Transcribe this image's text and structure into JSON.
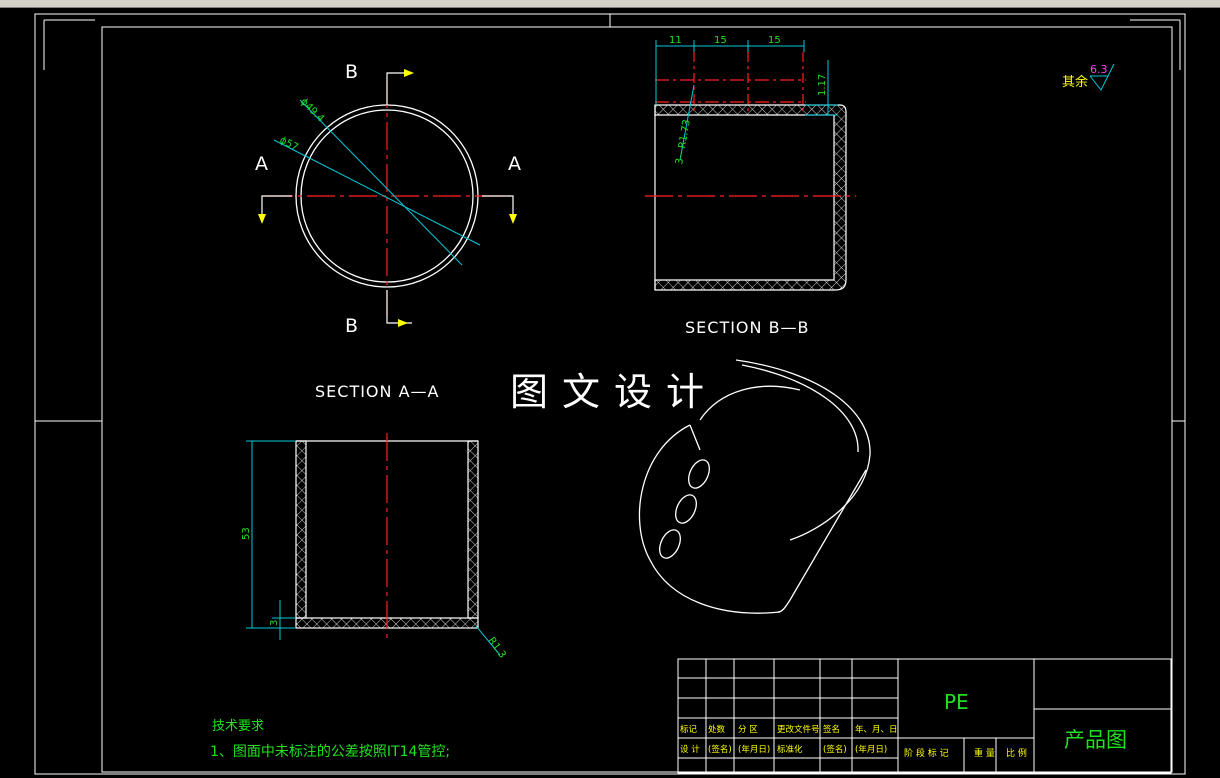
{
  "drawing": {
    "section_aa_label": "SECTION A—A",
    "section_bb_label": "SECTION B—B",
    "cut_labels": {
      "a_left": "A",
      "a_right": "A",
      "b_top": "B",
      "b_bottom": "B"
    },
    "dims_circle": {
      "d1": "ϕ49.4",
      "d2": "ϕ57"
    },
    "dims_bb": {
      "h1": "11",
      "h2": "15",
      "h3": "15",
      "v1": "1.17",
      "holes": "3—R1.73"
    },
    "dims_aa": {
      "height": "53",
      "bottom": "3",
      "radius": "R1.3"
    },
    "watermark": "图文设计",
    "roughness": {
      "prefix": "其余",
      "value": "6.3"
    },
    "requirements": {
      "title": "技术要求",
      "item1": "1、图面中未标注的公差按照IT14管控;"
    },
    "title_block": {
      "row1": [
        "标记",
        "处数",
        "分 区",
        "更改文件号",
        "签名",
        "年、月、日"
      ],
      "row2": [
        "设 计",
        "(签名)",
        "(年月日)",
        "标准化",
        "(签名)",
        "(年月日)"
      ],
      "stages": [
        "阶 段 标 记",
        "重 量",
        "比 例"
      ],
      "material": "PE",
      "drawing_name": "产品图"
    }
  },
  "colors": {
    "outline": "#ffffff",
    "center": "#ff2020",
    "dim": "#20e020",
    "leader": "#00c8d8",
    "yellow": "#ffff00",
    "magenta": "#ff40ff"
  }
}
